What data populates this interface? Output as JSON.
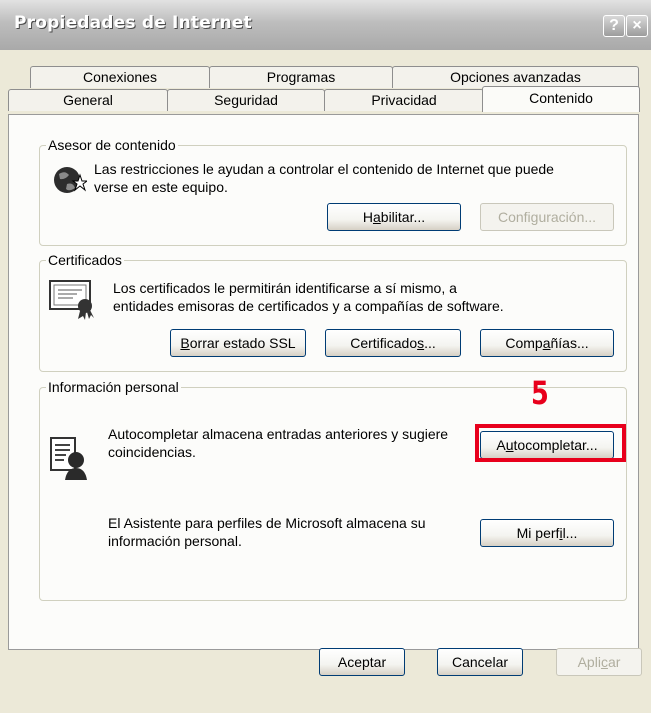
{
  "window": {
    "title": "Propiedades de Internet",
    "help_label": "?",
    "close_label": "×"
  },
  "tabs": {
    "row1": [
      "Conexiones",
      "Programas",
      "Opciones avanzadas"
    ],
    "row2": [
      "General",
      "Seguridad",
      "Privacidad",
      "Contenido"
    ],
    "active": "Contenido"
  },
  "content_advisor": {
    "legend": "Asesor de contenido",
    "text_line1": "Las restricciones le ayudan a controlar el contenido de Internet que puede",
    "text_line2": "verse en este equipo.",
    "enable_pre": "H",
    "enable_u": "a",
    "enable_post": "bilitar...",
    "settings_label": "Configuración..."
  },
  "certificates": {
    "legend": "Certificados",
    "text_line1": "Los certificados le permitirán identificarse a sí mismo, a",
    "text_line2": "entidades emisoras de certificados y a compañías de software.",
    "clear_ssl_pre": "",
    "clear_ssl_u": "B",
    "clear_ssl_post": "orrar estado SSL",
    "certs_pre": "Certificado",
    "certs_u": "s",
    "certs_post": "...",
    "publishers_pre": "Comp",
    "publishers_u": "a",
    "publishers_post": "ñías..."
  },
  "personal_info": {
    "legend": "Información personal",
    "autocomplete_line1": "Autocompletar almacena entradas anteriores y sugiere",
    "autocomplete_line2": "coincidencias.",
    "autocomplete_pre": "A",
    "autocomplete_u": "u",
    "autocomplete_post": "tocompletar...",
    "profile_line1": "El Asistente para perfiles de Microsoft almacena su",
    "profile_line2": "información personal.",
    "profile_pre": "Mi perf",
    "profile_u": "i",
    "profile_post": "l..."
  },
  "annotation": {
    "step_number": "5",
    "highlight_color": "#e8001c"
  },
  "footer": {
    "ok_label": "Aceptar",
    "cancel_label": "Cancelar",
    "apply_pre": "Apli",
    "apply_u": "c",
    "apply_post": "ar"
  }
}
